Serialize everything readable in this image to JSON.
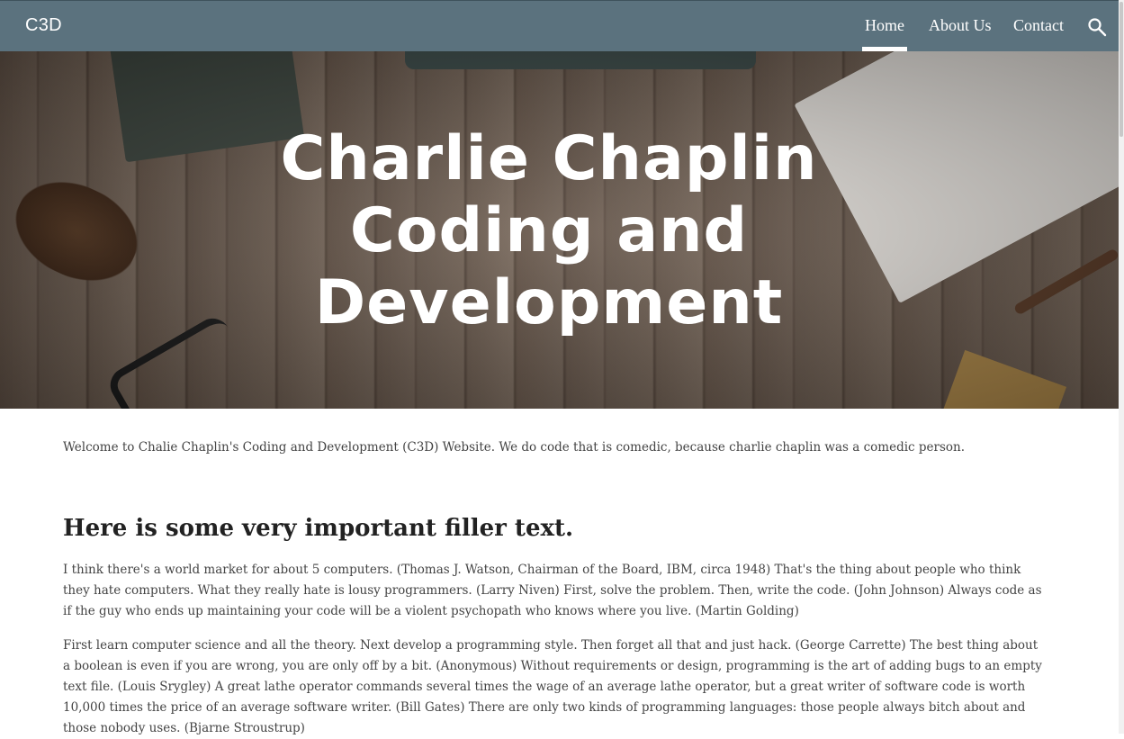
{
  "header": {
    "brand": "C3D",
    "nav": [
      "Home",
      "About Us",
      "Contact"
    ],
    "active_nav": "Home",
    "search_icon": "search-icon"
  },
  "hero": {
    "title_lines": [
      "Charlie Chaplin",
      "Coding and",
      "Development"
    ]
  },
  "main": {
    "welcome": "Welcome to Chalie Chaplin's Coding and Development  (C3D) Website. We do code that is comedic, because charlie chaplin was a comedic person.",
    "heading": "Here is some very important filler text.",
    "paragraphs": [
      "I think there's a world market for about 5 computers. (Thomas J. Watson, Chairman of the Board, IBM, circa 1948) That's the thing about people who think they hate computers. What they really hate is lousy programmers. (Larry Niven) First, solve the problem. Then, write the code. (John Johnson) Always code as if the guy who ends up maintaining your code will be a violent psychopath who knows where you live. (Martin Golding)",
      "First learn computer science and all the theory. Next develop a programming style. Then forget all that and just hack. (George Carrette) The best thing about a boolean is even if you are wrong, you are only off by a bit. (Anonymous) Without requirements or design, programming is the art of adding bugs to an empty text file. (Louis Srygley) A great lathe operator commands several times the wage of an average lathe operator, but a great writer of software code is worth 10,000 times the price of an average software writer. (Bill Gates) There are only two kinds of programming languages: those people always bitch about and those nobody uses. (Bjarne Stroustrup)"
    ]
  },
  "colors": {
    "header_bg": "#5b727e",
    "text": "#444444",
    "heading": "#222222"
  }
}
